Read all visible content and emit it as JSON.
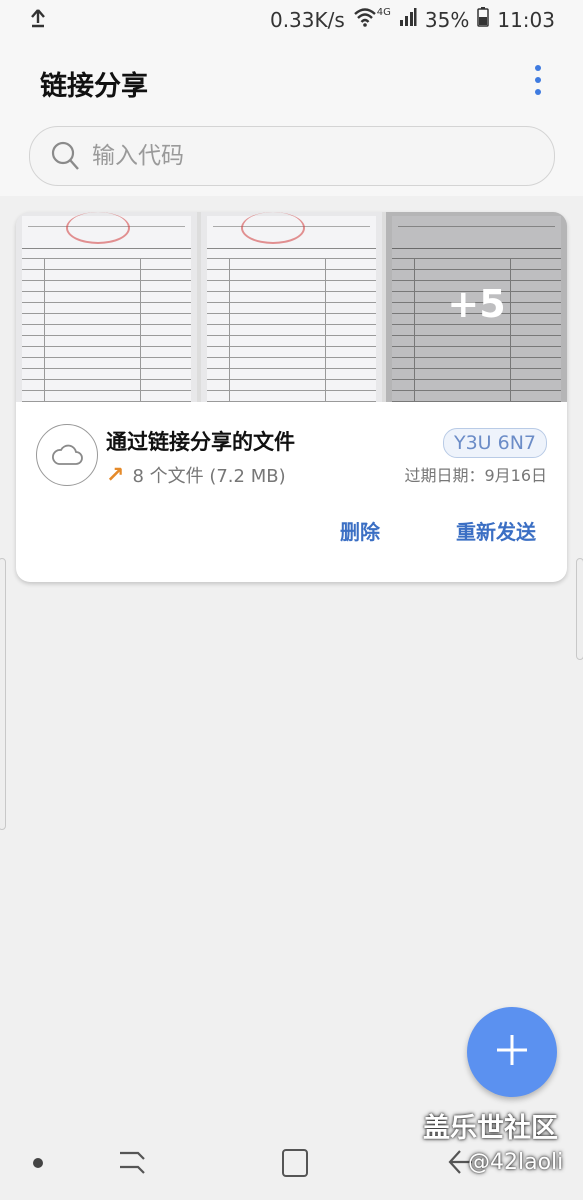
{
  "status_bar": {
    "speed": "0.33K/s",
    "network_tag": "4G",
    "battery": "35%",
    "time": "11:03"
  },
  "header": {
    "title": "链接分享",
    "more_icon": "more-vertical-icon"
  },
  "search": {
    "placeholder": "输入代码"
  },
  "share_card": {
    "title": "通过链接分享的文件",
    "file_count": "8 个文件 (7.2 MB)",
    "code": "Y3U 6N7",
    "expiry": "过期日期：9月16日",
    "more_count": "+5",
    "delete_label": "删除",
    "resend_label": "重新发送"
  },
  "colors": {
    "accent": "#3b6fc4",
    "fab": "#5b91f0",
    "arrow": "#e58a2a"
  },
  "watermark": {
    "brand": "盖乐世社区",
    "user": "@42laoli"
  }
}
